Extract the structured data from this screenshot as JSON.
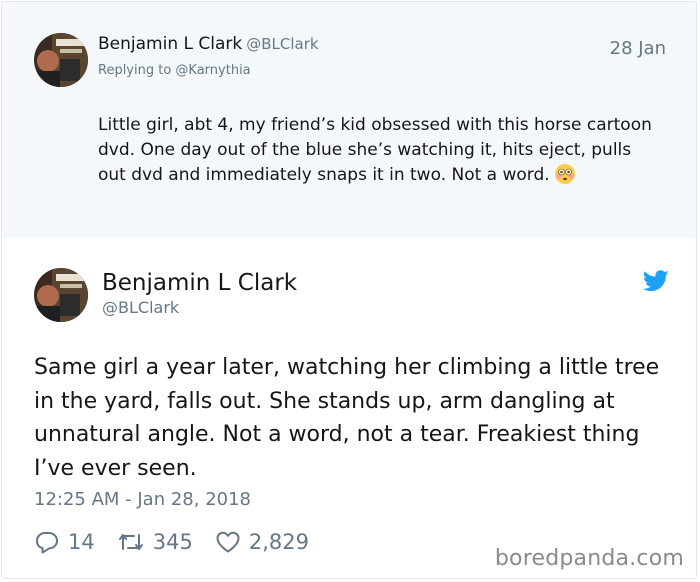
{
  "reply_tweet": {
    "author_name": "Benjamin L Clark",
    "author_handle": "@BLClark",
    "date": "28 Jan",
    "replying_to": "Replying to @Karnythia",
    "text": "Little girl, abt 4, my friend’s kid obsessed with this horse cartoon dvd. One day out of the blue she’s watching it, hits eject, pulls out dvd and immediately snaps it in two. Not a word.",
    "emoji": "flushed-face-emoji"
  },
  "main_tweet": {
    "author_name": "Benjamin L Clark",
    "author_handle": "@BLClark",
    "text": "Same girl a year later, watching her climbing a little tree in the yard, falls out. She stands up, arm dangling at unnatural angle. Not a word, not a tear. Freakiest thing I’ve ever seen.",
    "timestamp": "12:25 AM - Jan 28, 2018",
    "replies": "14",
    "retweets": "345",
    "likes": "2,829"
  },
  "watermark": "boredpanda.com",
  "colors": {
    "twitter_blue": "#1da1f2",
    "secondary_text": "#657786",
    "reply_background": "#f5f8fa"
  }
}
